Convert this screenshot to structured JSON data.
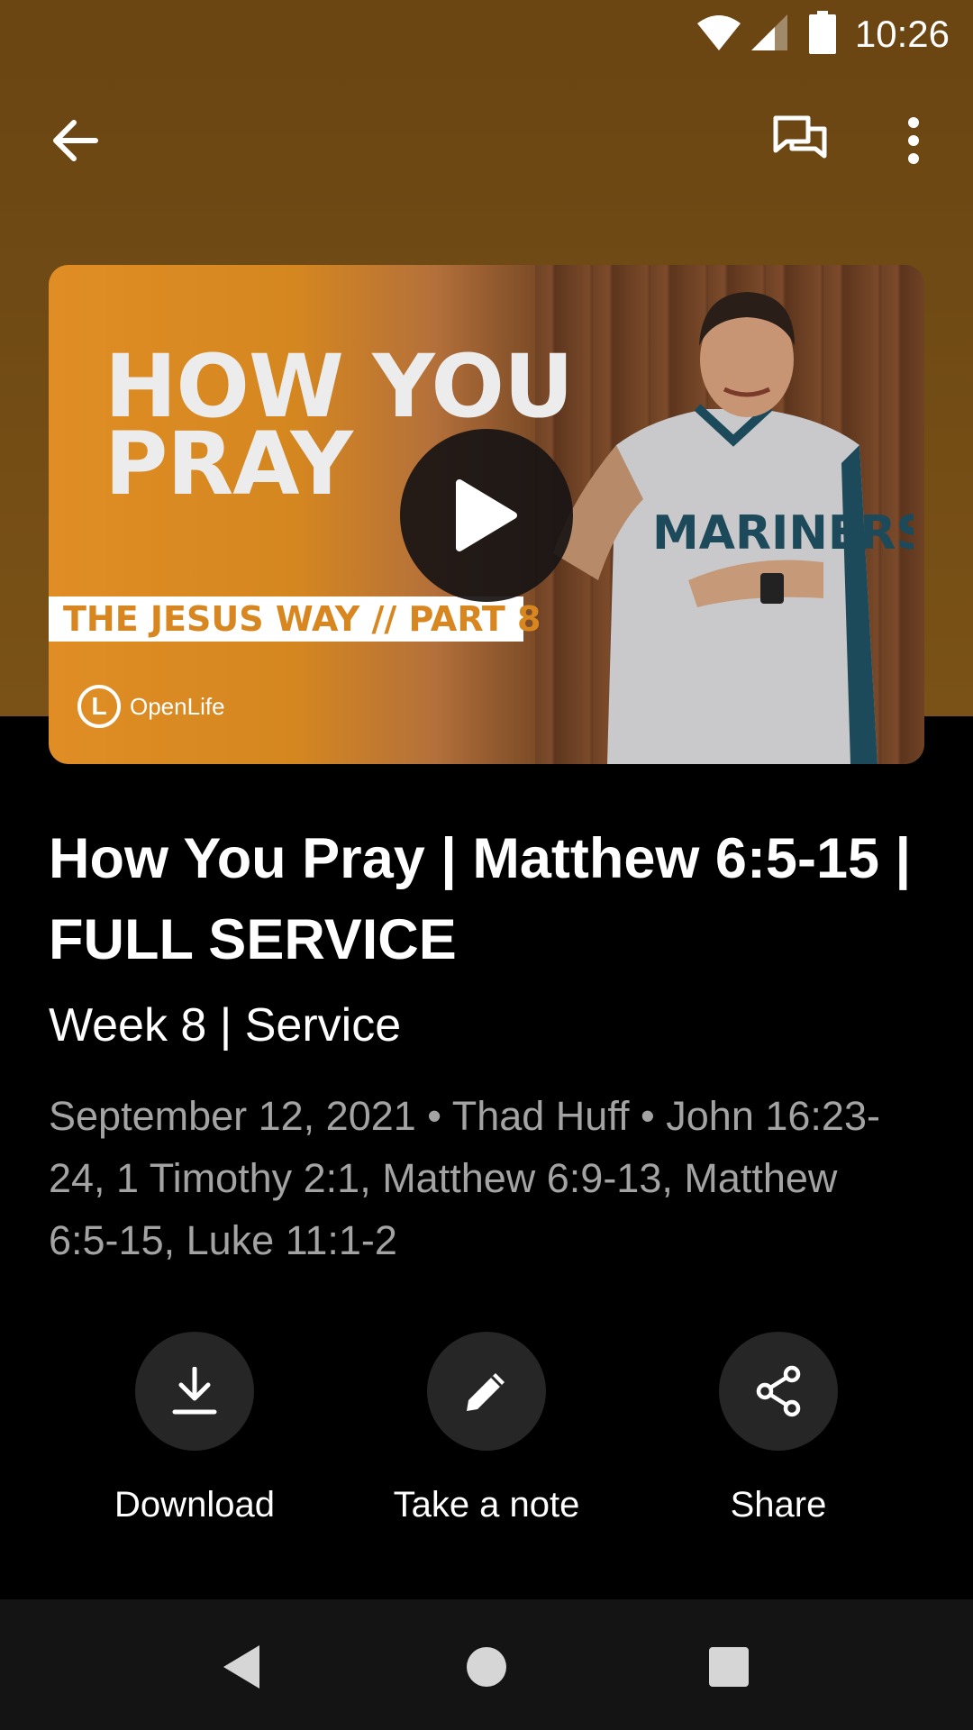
{
  "status_bar": {
    "time": "10:26",
    "icons": [
      "wifi-icon",
      "signal-icon",
      "battery-icon"
    ]
  },
  "toolbar": {
    "back_icon": "arrow-left-icon",
    "chat_icon": "chat-icon",
    "more_icon": "more-vert-icon"
  },
  "thumbnail": {
    "title": "HOW YOU\nPRAY",
    "banner": "THE JESUS WAY // PART 8",
    "logo_letter": "L",
    "logo_text": "OpenLife",
    "shirt_text": "MARINERS",
    "play_icon": "play-icon"
  },
  "content": {
    "title": "How You Pray | Matthew 6:5-15 | FULL SERVICE",
    "subtitle": "Week 8 | Service",
    "meta": "September 12, 2021 • Thad Huff • John 16:23-24, 1 Timothy 2:1, Matthew 6:9-13, Matthew 6:5-15, Luke 11:1-2"
  },
  "actions": [
    {
      "label": "Download",
      "icon": "download-icon"
    },
    {
      "label": "Take a note",
      "icon": "pencil-icon"
    },
    {
      "label": "Share",
      "icon": "share-icon"
    }
  ],
  "nav": {
    "back": "nav-back-icon",
    "home": "nav-home-icon",
    "recents": "nav-recents-icon"
  },
  "colors": {
    "header_bg": "#704a14",
    "accent_orange": "#d8861f",
    "background": "#000000",
    "meta_text": "#a3a3a3"
  }
}
